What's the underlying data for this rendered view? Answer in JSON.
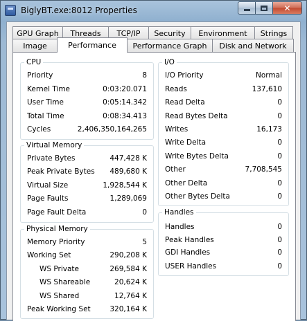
{
  "window": {
    "title": "BiglyBT.exe:8012 Properties"
  },
  "tabs": {
    "back": [
      "GPU Graph",
      "Threads",
      "TCP/IP",
      "Security",
      "Environment",
      "Strings"
    ],
    "front": [
      "Image",
      "Performance",
      "Performance Graph",
      "Disk and Network"
    ],
    "active": "Performance"
  },
  "cpu": {
    "title": "CPU",
    "rows": [
      {
        "label": "Priority",
        "value": "8"
      },
      {
        "label": "Kernel Time",
        "value": "0:03:20.071"
      },
      {
        "label": "User Time",
        "value": "0:05:14.342"
      },
      {
        "label": "Total Time",
        "value": "0:08:34.413"
      },
      {
        "label": "Cycles",
        "value": "2,406,350,164,265"
      }
    ]
  },
  "virtual_memory": {
    "title": "Virtual Memory",
    "rows": [
      {
        "label": "Private Bytes",
        "value": "447,428 K"
      },
      {
        "label": "Peak Private Bytes",
        "value": "489,680 K"
      },
      {
        "label": "Virtual Size",
        "value": "1,928,544 K"
      },
      {
        "label": "Page Faults",
        "value": "1,289,069"
      },
      {
        "label": "Page Fault Delta",
        "value": "0"
      }
    ]
  },
  "physical_memory": {
    "title": "Physical Memory",
    "rows": [
      {
        "label": "Memory Priority",
        "value": "5"
      },
      {
        "label": "Working Set",
        "value": "290,208 K"
      },
      {
        "label": "WS Private",
        "value": "269,584 K"
      },
      {
        "label": "WS Shareable",
        "value": "20,624 K"
      },
      {
        "label": "WS Shared",
        "value": "12,764 K"
      },
      {
        "label": "Peak Working Set",
        "value": "320,164 K"
      }
    ]
  },
  "io": {
    "title": "I/O",
    "rows": [
      {
        "label": "I/O Priority",
        "value": "Normal"
      },
      {
        "label": "Reads",
        "value": "137,610"
      },
      {
        "label": "Read Delta",
        "value": "0"
      },
      {
        "label": "Read Bytes Delta",
        "value": "0"
      },
      {
        "label": "Writes",
        "value": "16,173"
      },
      {
        "label": "Write Delta",
        "value": "0"
      },
      {
        "label": "Write Bytes Delta",
        "value": "0"
      },
      {
        "label": "Other",
        "value": "7,708,545"
      },
      {
        "label": "Other Delta",
        "value": "0"
      },
      {
        "label": "Other Bytes Delta",
        "value": "0"
      }
    ]
  },
  "handles": {
    "title": "Handles",
    "rows": [
      {
        "label": "Handles",
        "value": "0"
      },
      {
        "label": "Peak Handles",
        "value": "0"
      },
      {
        "label": "GDI Handles",
        "value": "0"
      },
      {
        "label": "USER Handles",
        "value": "0"
      }
    ]
  }
}
